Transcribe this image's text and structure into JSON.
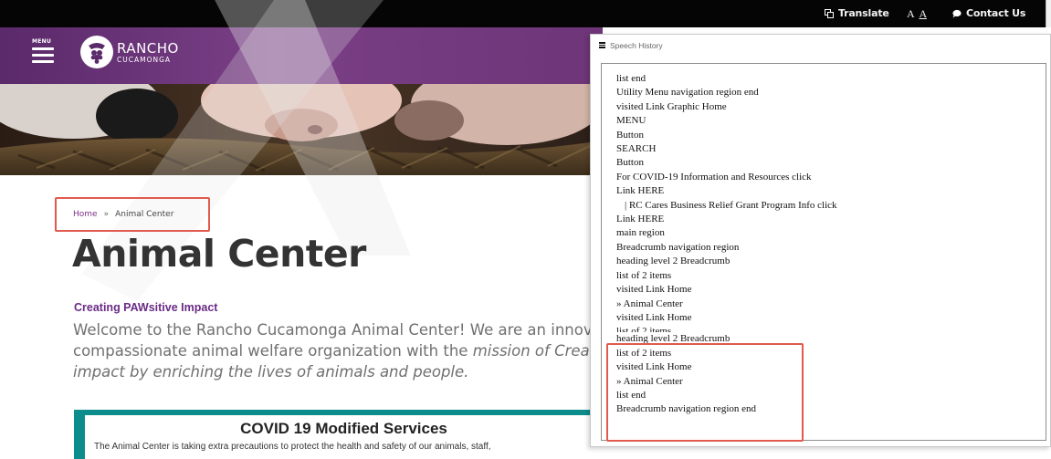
{
  "utility": {
    "translate_label": "Translate",
    "text_size_small": "A",
    "text_size_large": "A",
    "contact_label": "Contact Us"
  },
  "header": {
    "menu_label": "MENU",
    "logo_main": "RANCHO",
    "logo_sub": "CUCAMONGA"
  },
  "breadcrumb": {
    "home": "Home",
    "separator": "»",
    "current": "Animal Center"
  },
  "main": {
    "title": "Animal Center",
    "subheading": "Creating PAWsitive Impact",
    "intro_line1": "Welcome to the Rancho Cucamonga Animal Center!  We are an innovati",
    "intro_line2_plain": "compassionate animal welfare organization with the ",
    "intro_line2_em": "mission of Creating F",
    "intro_line3_em": "impact by enriching the lives of animals and people.",
    "covid_title": "COVID 19 Modified Services",
    "covid_body": "The Animal Center is taking extra precautions to protect the health and safety of our animals, staff,"
  },
  "speech_history": {
    "title": "Speech History",
    "lines": [
      "list end",
      "Utility Menu navigation region end",
      "visited Link Graphic Home",
      "MENU",
      "Button",
      "SEARCH",
      "Button",
      "For COVID-19 Information and Resources click",
      "Link HERE",
      "  | RC Cares Business Relief Grant Program Info click",
      "Link HERE",
      "main region",
      "Breadcrumb navigation region",
      "heading level 2 Breadcrumb",
      "list of 2 items",
      "visited Link Home",
      "» Animal Center",
      "visited Link Home",
      "list of 2 items",
      "heading level 2 Breadcrumb",
      "list of 2 items",
      "visited Link Home",
      "» Animal Center",
      "list end",
      "Breadcrumb navigation region end"
    ]
  },
  "colors": {
    "header_purple": "#6e3578",
    "annotation_red": "#e05a4e",
    "covid_teal": "#0c8d8b",
    "subheading_purple": "#6a2b86"
  },
  "icons": [
    "translate-icon",
    "contact-bubble-icon",
    "menu-icon",
    "logo-grapes-icon",
    "speech-menu-icon"
  ]
}
